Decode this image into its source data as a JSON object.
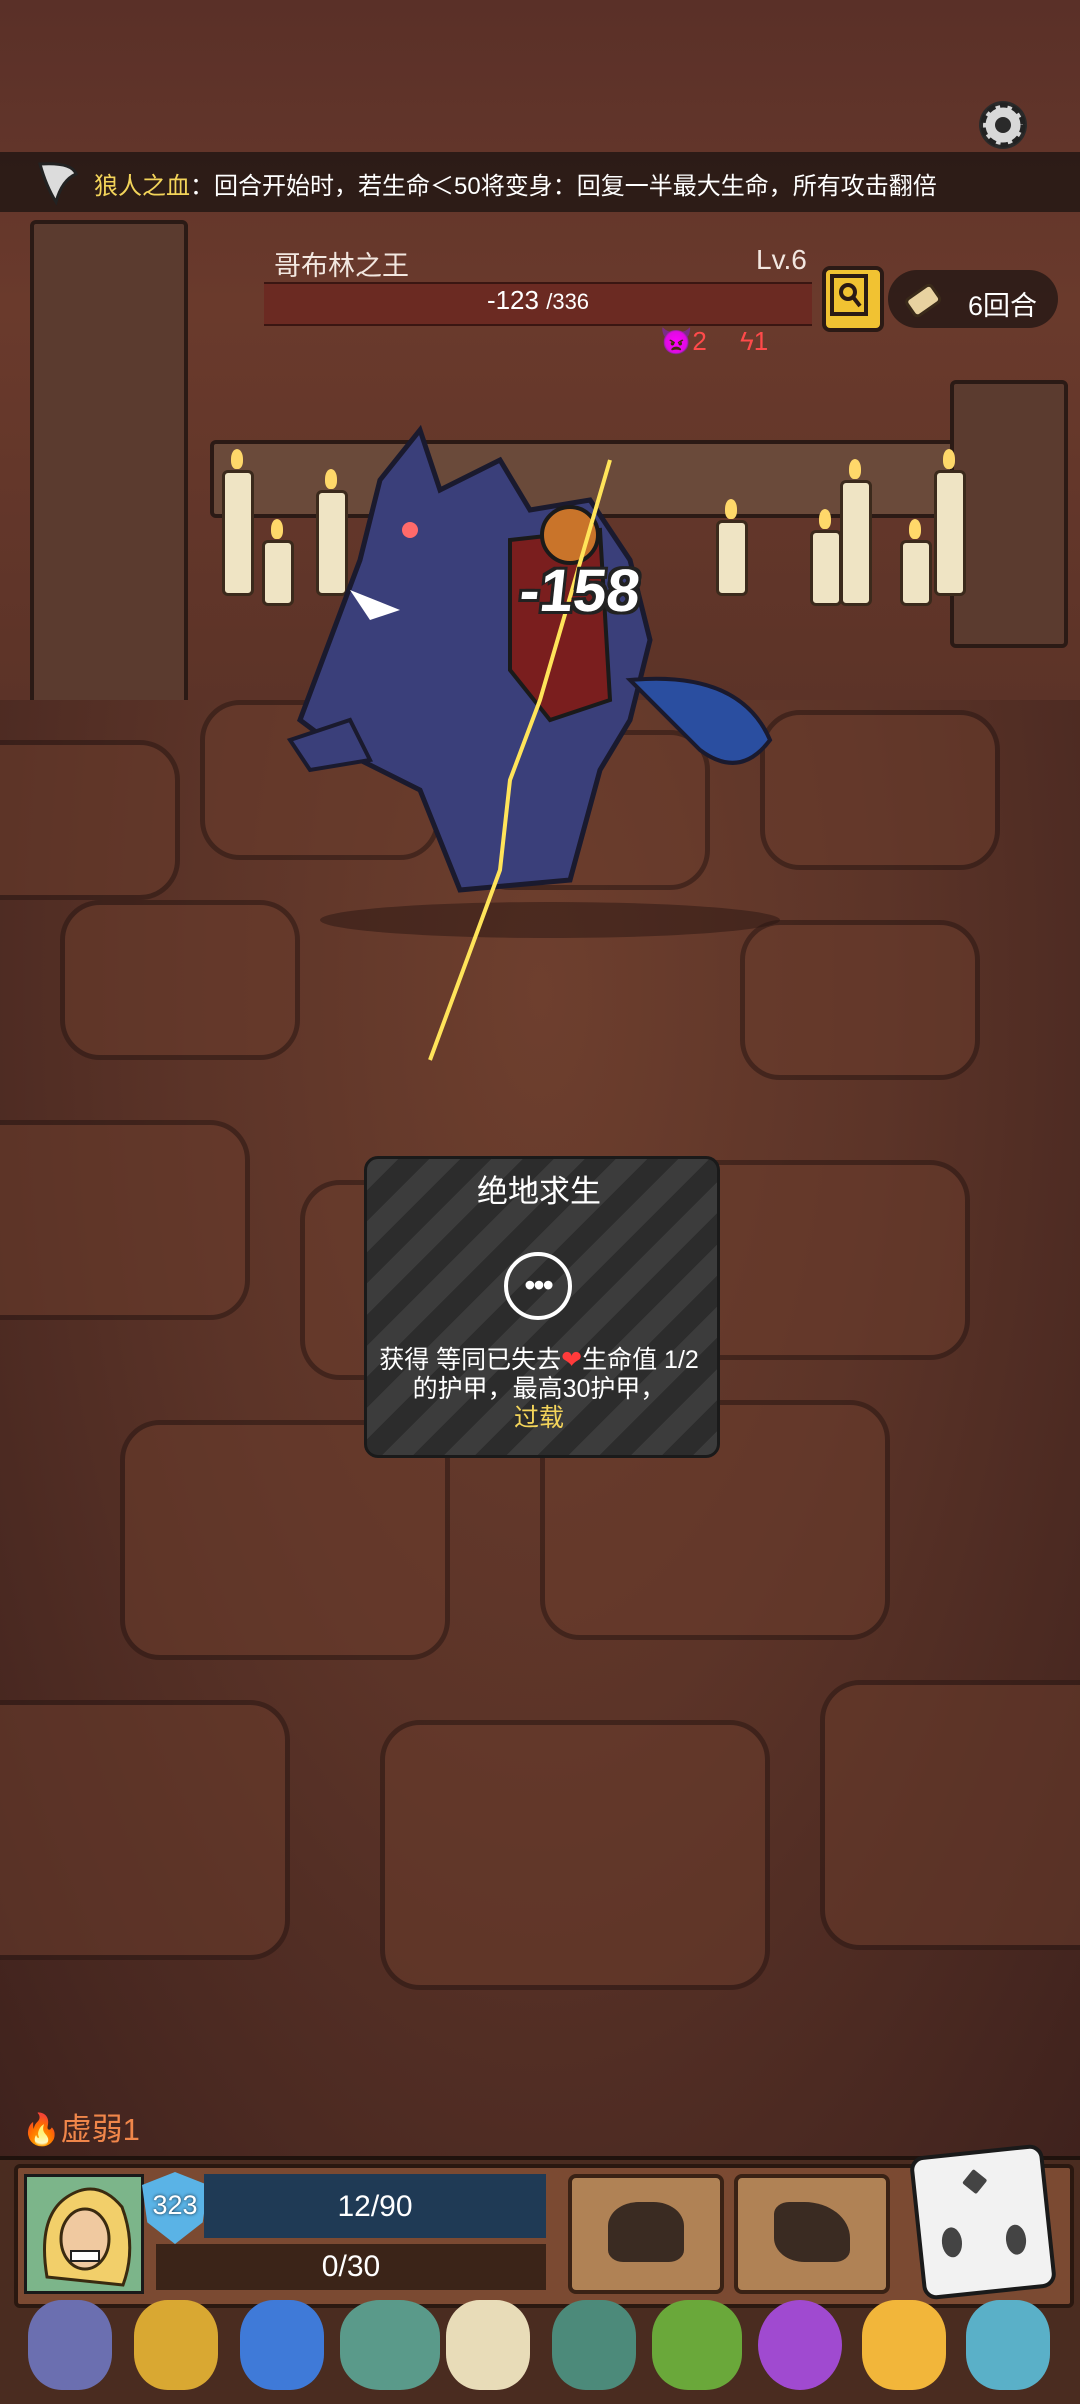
{
  "passive": {
    "name": "狼人之血",
    "description": "：回合开始时，若生命＜50将变身：回复一半最大生命，所有攻击翻倍"
  },
  "enemy": {
    "name": "哥布林之王",
    "level": "Lv.6",
    "hp_change": "-123",
    "hp_max": "/336",
    "intents": [
      "2",
      "1"
    ]
  },
  "turns": "6回合",
  "damage_popup": "-158",
  "tooltip": {
    "title": "绝地求生",
    "icon": "ellipsis-icon",
    "desc_prefix": "获得 等同已失去",
    "desc_heart": "❤",
    "desc_middle": "生命值 1/2 的护甲，最高30护甲，",
    "keyword": "过载"
  },
  "status": {
    "label": "虚弱1"
  },
  "player": {
    "shield": "323",
    "hp": "12/90",
    "energy": "0/30"
  },
  "colors": {
    "accent_gold": "#f3d45a",
    "hp_bar": "#6b2a22",
    "player_hp_bar": "#1f3a55",
    "shield": "#5ab3e6",
    "status_orange": "#f0864a"
  },
  "relics": [
    "claw-gauntlet-icon",
    "golden-claws-icon",
    "blue-mushroom-icon",
    "green-cleaver-icon",
    "horns-icon",
    "teapot-icon",
    "clover-icon",
    "poison-flask-icon",
    "golden-hand-icon",
    "slime-icon"
  ]
}
